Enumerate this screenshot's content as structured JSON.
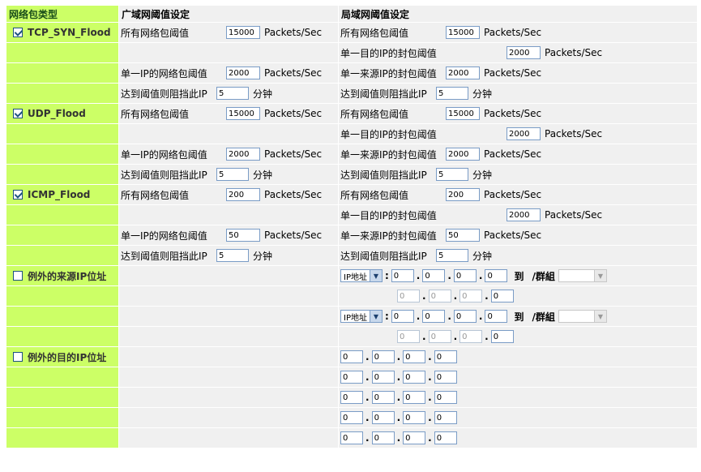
{
  "headers": {
    "type": "网络包类型",
    "wan": "广域网阈值设定",
    "lan": "局域网阈值设定"
  },
  "labels": {
    "all_packets": "所有网络包阈值",
    "per_dest_ip": "单一目的IP的封包阈值",
    "per_ip": "单一IP的网络包阈值",
    "per_src_ip": "单一来源IP的封包阈值",
    "block": "达到阈值则阻挡此IP",
    "unit_pps": "Packets/Sec",
    "unit_min": "分钟",
    "ip_type": "IP地址",
    "to": "到",
    "group": "/群組"
  },
  "floods": [
    {
      "name": "TCP_SYN_Flood",
      "checked": true,
      "wan_all": "15000",
      "lan_all": "15000",
      "lan_dest": "2000",
      "wan_ip": "2000",
      "lan_src": "2000",
      "wan_block": "5",
      "lan_block": "5"
    },
    {
      "name": "UDP_Flood",
      "checked": true,
      "wan_all": "15000",
      "lan_all": "15000",
      "lan_dest": "2000",
      "wan_ip": "2000",
      "lan_src": "2000",
      "wan_block": "5",
      "lan_block": "5"
    },
    {
      "name": "ICMP_Flood",
      "checked": true,
      "wan_all": "200",
      "lan_all": "200",
      "lan_dest": "2000",
      "wan_ip": "50",
      "lan_src": "50",
      "wan_block": "5",
      "lan_block": "5"
    }
  ],
  "exceptions": {
    "src_label": "例外的来源IP位址",
    "src_checked": false,
    "dst_label": "例外的目的IP位址",
    "dst_checked": false,
    "ip_zero": "0"
  }
}
